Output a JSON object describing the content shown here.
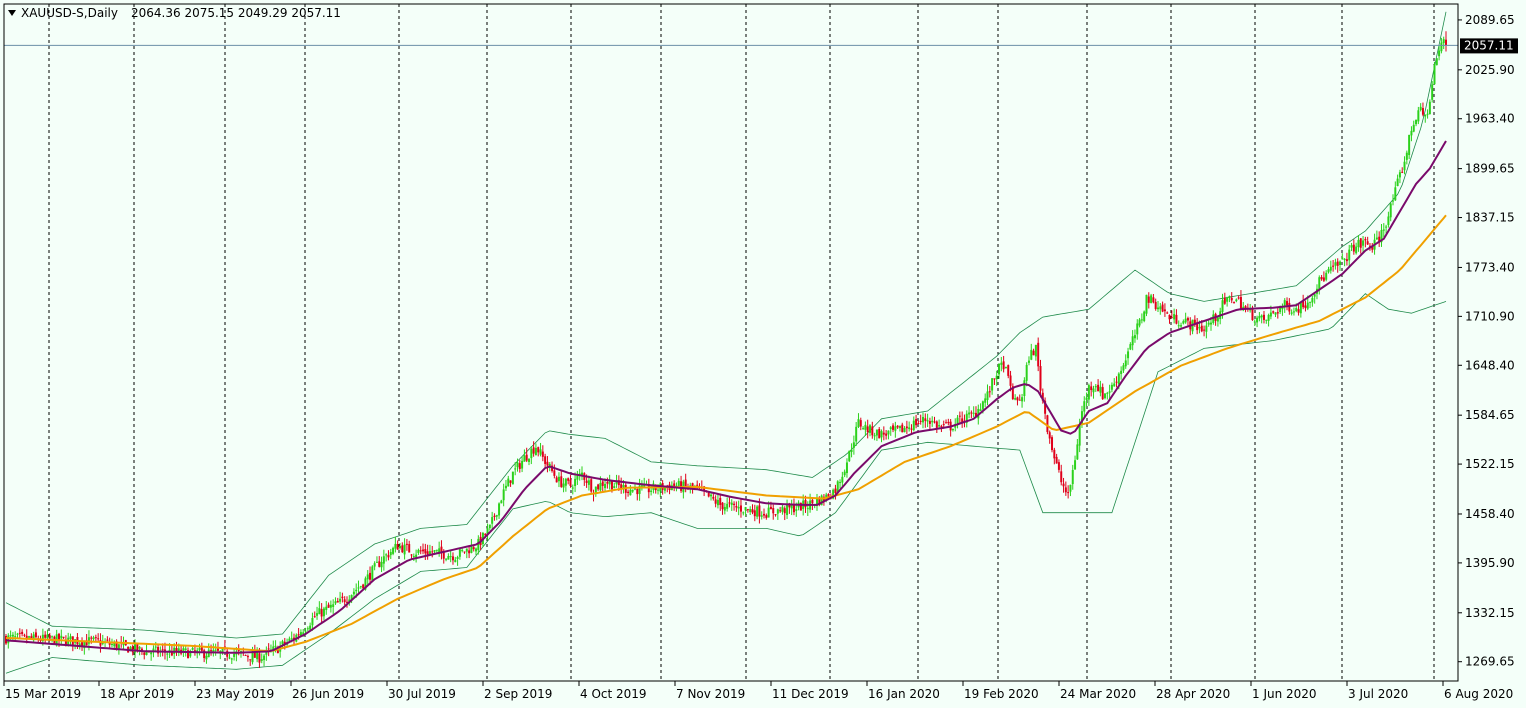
{
  "header": {
    "symbol": "XAUUSD-S,Daily",
    "ohlc": "2064.36 2075.15 2049.29 2057.11"
  },
  "colors": {
    "background": "#f4fff9",
    "bull": "#2bd11b",
    "bear": "#e0001a",
    "ma_fast": "#7a0a6b",
    "ma_slow": "#f0a000",
    "bands": "#1e8a4a",
    "grid": "#000000",
    "price_line": "#6b8fa8",
    "price_tag_bg": "#000000"
  },
  "chart_data": {
    "type": "candlestick",
    "symbol": "XAUUSD-S",
    "timeframe": "Daily",
    "last": {
      "open": 2064.36,
      "high": 2075.15,
      "low": 2049.29,
      "close": 2057.11
    },
    "current_price_label": "2057.11",
    "y_ticks": [
      "2089.65",
      "2025.90",
      "1963.40",
      "1899.65",
      "1837.15",
      "1773.40",
      "1710.90",
      "1648.40",
      "1584.65",
      "1522.15",
      "1458.40",
      "1395.90",
      "1332.15",
      "1269.65"
    ],
    "y_tick_values": [
      2089.65,
      2025.9,
      1963.4,
      1899.65,
      1837.15,
      1773.4,
      1710.9,
      1648.4,
      1584.65,
      1522.15,
      1458.4,
      1395.9,
      1332.15,
      1269.65
    ],
    "ylim": [
      1245,
      2110
    ],
    "x_labels": [
      "15 Mar 2019",
      "18 Apr 2019",
      "23 May 2019",
      "26 Jun 2019",
      "30 Jul 2019",
      "2 Sep 2019",
      "4 Oct 2019",
      "7 Nov 2019",
      "11 Dec 2019",
      "16 Jan 2020",
      "19 Feb 2020",
      "24 Mar 2020",
      "28 Apr 2020",
      "1 Jun 2020",
      "3 Jul 2020",
      "6 Aug 2020"
    ],
    "close_path": [
      [
        0,
        1300
      ],
      [
        20,
        1298
      ],
      [
        40,
        1295
      ],
      [
        60,
        1283
      ],
      [
        80,
        1281
      ],
      [
        100,
        1280
      ],
      [
        110,
        1275
      ],
      [
        118,
        1287
      ],
      [
        125,
        1300
      ],
      [
        135,
        1330
      ],
      [
        145,
        1345
      ],
      [
        155,
        1370
      ],
      [
        163,
        1400
      ],
      [
        170,
        1418
      ],
      [
        177,
        1410
      ],
      [
        185,
        1410
      ],
      [
        195,
        1405
      ],
      [
        205,
        1420
      ],
      [
        210,
        1440
      ],
      [
        215,
        1480
      ],
      [
        220,
        1510
      ],
      [
        225,
        1530
      ],
      [
        230,
        1545
      ],
      [
        233,
        1530
      ],
      [
        240,
        1500
      ],
      [
        245,
        1495
      ],
      [
        250,
        1510
      ],
      [
        255,
        1490
      ],
      [
        260,
        1500
      ],
      [
        270,
        1490
      ],
      [
        280,
        1490
      ],
      [
        290,
        1495
      ],
      [
        300,
        1490
      ],
      [
        310,
        1470
      ],
      [
        320,
        1465
      ],
      [
        330,
        1460
      ],
      [
        340,
        1465
      ],
      [
        348,
        1470
      ],
      [
        352,
        1475
      ],
      [
        356,
        1480
      ],
      [
        360,
        1490
      ],
      [
        363,
        1510
      ],
      [
        366,
        1535
      ],
      [
        370,
        1575
      ],
      [
        375,
        1565
      ],
      [
        380,
        1560
      ],
      [
        388,
        1565
      ],
      [
        395,
        1575
      ],
      [
        400,
        1580
      ],
      [
        405,
        1570
      ],
      [
        410,
        1570
      ],
      [
        415,
        1580
      ],
      [
        420,
        1585
      ],
      [
        426,
        1610
      ],
      [
        430,
        1640
      ],
      [
        433,
        1650
      ],
      [
        436,
        1620
      ],
      [
        438,
        1600
      ],
      [
        441,
        1610
      ],
      [
        444,
        1660
      ],
      [
        447,
        1670
      ],
      [
        449,
        1620
      ],
      [
        452,
        1570
      ],
      [
        455,
        1530
      ],
      [
        458,
        1500
      ],
      [
        461,
        1480
      ],
      [
        464,
        1530
      ],
      [
        467,
        1590
      ],
      [
        470,
        1620
      ],
      [
        473,
        1625
      ],
      [
        476,
        1610
      ],
      [
        480,
        1620
      ],
      [
        485,
        1650
      ],
      [
        489,
        1680
      ],
      [
        493,
        1710
      ],
      [
        495,
        1735
      ],
      [
        500,
        1725
      ],
      [
        505,
        1710
      ],
      [
        510,
        1705
      ],
      [
        515,
        1700
      ],
      [
        520,
        1695
      ],
      [
        525,
        1710
      ],
      [
        528,
        1725
      ],
      [
        532,
        1735
      ],
      [
        535,
        1730
      ],
      [
        538,
        1720
      ],
      [
        542,
        1710
      ],
      [
        546,
        1705
      ],
      [
        550,
        1715
      ],
      [
        555,
        1725
      ],
      [
        560,
        1720
      ],
      [
        565,
        1730
      ],
      [
        570,
        1755
      ],
      [
        575,
        1770
      ],
      [
        580,
        1780
      ],
      [
        585,
        1800
      ],
      [
        590,
        1805
      ],
      [
        593,
        1800
      ],
      [
        596,
        1810
      ],
      [
        600,
        1840
      ],
      [
        604,
        1880
      ],
      [
        607,
        1910
      ],
      [
        610,
        1950
      ],
      [
        613,
        1975
      ],
      [
        616,
        1965
      ],
      [
        618,
        1985
      ],
      [
        620,
        2030
      ],
      [
        622,
        2050
      ],
      [
        624,
        2064
      ],
      [
        625,
        2057
      ]
    ],
    "total_bars": 626,
    "ma_fast_path": [
      [
        0,
        1297
      ],
      [
        30,
        1290
      ],
      [
        60,
        1283
      ],
      [
        100,
        1281
      ],
      [
        115,
        1283
      ],
      [
        130,
        1305
      ],
      [
        145,
        1335
      ],
      [
        160,
        1375
      ],
      [
        175,
        1400
      ],
      [
        190,
        1410
      ],
      [
        205,
        1420
      ],
      [
        215,
        1450
      ],
      [
        225,
        1490
      ],
      [
        235,
        1520
      ],
      [
        245,
        1510
      ],
      [
        260,
        1502
      ],
      [
        280,
        1495
      ],
      [
        300,
        1490
      ],
      [
        315,
        1480
      ],
      [
        330,
        1472
      ],
      [
        345,
        1470
      ],
      [
        352,
        1470
      ],
      [
        360,
        1482
      ],
      [
        368,
        1510
      ],
      [
        380,
        1545
      ],
      [
        395,
        1563
      ],
      [
        410,
        1570
      ],
      [
        420,
        1580
      ],
      [
        430,
        1605
      ],
      [
        437,
        1620
      ],
      [
        443,
        1625
      ],
      [
        448,
        1615
      ],
      [
        453,
        1590
      ],
      [
        458,
        1565
      ],
      [
        463,
        1560
      ],
      [
        470,
        1590
      ],
      [
        478,
        1600
      ],
      [
        486,
        1635
      ],
      [
        495,
        1670
      ],
      [
        505,
        1690
      ],
      [
        520,
        1705
      ],
      [
        535,
        1720
      ],
      [
        550,
        1722
      ],
      [
        560,
        1725
      ],
      [
        570,
        1745
      ],
      [
        580,
        1765
      ],
      [
        590,
        1795
      ],
      [
        598,
        1810
      ],
      [
        605,
        1845
      ],
      [
        612,
        1880
      ],
      [
        618,
        1900
      ],
      [
        625,
        1935
      ]
    ],
    "ma_slow_path": [
      [
        0,
        1300
      ],
      [
        40,
        1295
      ],
      [
        80,
        1290
      ],
      [
        115,
        1283
      ],
      [
        130,
        1295
      ],
      [
        150,
        1318
      ],
      [
        170,
        1350
      ],
      [
        190,
        1375
      ],
      [
        205,
        1390
      ],
      [
        220,
        1430
      ],
      [
        235,
        1465
      ],
      [
        250,
        1482
      ],
      [
        270,
        1492
      ],
      [
        300,
        1493
      ],
      [
        330,
        1482
      ],
      [
        355,
        1478
      ],
      [
        370,
        1490
      ],
      [
        390,
        1525
      ],
      [
        410,
        1545
      ],
      [
        430,
        1570
      ],
      [
        443,
        1590
      ],
      [
        455,
        1565
      ],
      [
        470,
        1575
      ],
      [
        490,
        1615
      ],
      [
        510,
        1648
      ],
      [
        530,
        1670
      ],
      [
        550,
        1688
      ],
      [
        570,
        1705
      ],
      [
        590,
        1735
      ],
      [
        605,
        1770
      ],
      [
        615,
        1805
      ],
      [
        625,
        1840
      ]
    ],
    "bb_upper_path": [
      [
        0,
        1345
      ],
      [
        20,
        1315
      ],
      [
        60,
        1310
      ],
      [
        100,
        1300
      ],
      [
        120,
        1305
      ],
      [
        140,
        1380
      ],
      [
        160,
        1420
      ],
      [
        180,
        1440
      ],
      [
        200,
        1445
      ],
      [
        220,
        1520
      ],
      [
        235,
        1565
      ],
      [
        245,
        1560
      ],
      [
        260,
        1555
      ],
      [
        280,
        1525
      ],
      [
        300,
        1520
      ],
      [
        330,
        1515
      ],
      [
        350,
        1505
      ],
      [
        365,
        1535
      ],
      [
        380,
        1580
      ],
      [
        400,
        1590
      ],
      [
        430,
        1660
      ],
      [
        440,
        1690
      ],
      [
        450,
        1710
      ],
      [
        470,
        1720
      ],
      [
        490,
        1770
      ],
      [
        505,
        1740
      ],
      [
        520,
        1730
      ],
      [
        540,
        1740
      ],
      [
        560,
        1750
      ],
      [
        580,
        1800
      ],
      [
        590,
        1820
      ],
      [
        605,
        1870
      ],
      [
        615,
        1960
      ],
      [
        625,
        2100
      ]
    ],
    "bb_lower_path": [
      [
        0,
        1255
      ],
      [
        20,
        1275
      ],
      [
        60,
        1265
      ],
      [
        100,
        1260
      ],
      [
        120,
        1265
      ],
      [
        140,
        1305
      ],
      [
        160,
        1350
      ],
      [
        180,
        1385
      ],
      [
        200,
        1390
      ],
      [
        220,
        1465
      ],
      [
        235,
        1475
      ],
      [
        245,
        1460
      ],
      [
        260,
        1455
      ],
      [
        280,
        1460
      ],
      [
        300,
        1440
      ],
      [
        330,
        1440
      ],
      [
        345,
        1430
      ],
      [
        360,
        1460
      ],
      [
        380,
        1540
      ],
      [
        400,
        1550
      ],
      [
        420,
        1545
      ],
      [
        440,
        1540
      ],
      [
        450,
        1460
      ],
      [
        470,
        1460
      ],
      [
        480,
        1460
      ],
      [
        490,
        1550
      ],
      [
        500,
        1640
      ],
      [
        520,
        1670
      ],
      [
        550,
        1680
      ],
      [
        575,
        1695
      ],
      [
        590,
        1740
      ],
      [
        600,
        1720
      ],
      [
        610,
        1715
      ],
      [
        625,
        1730
      ]
    ]
  }
}
